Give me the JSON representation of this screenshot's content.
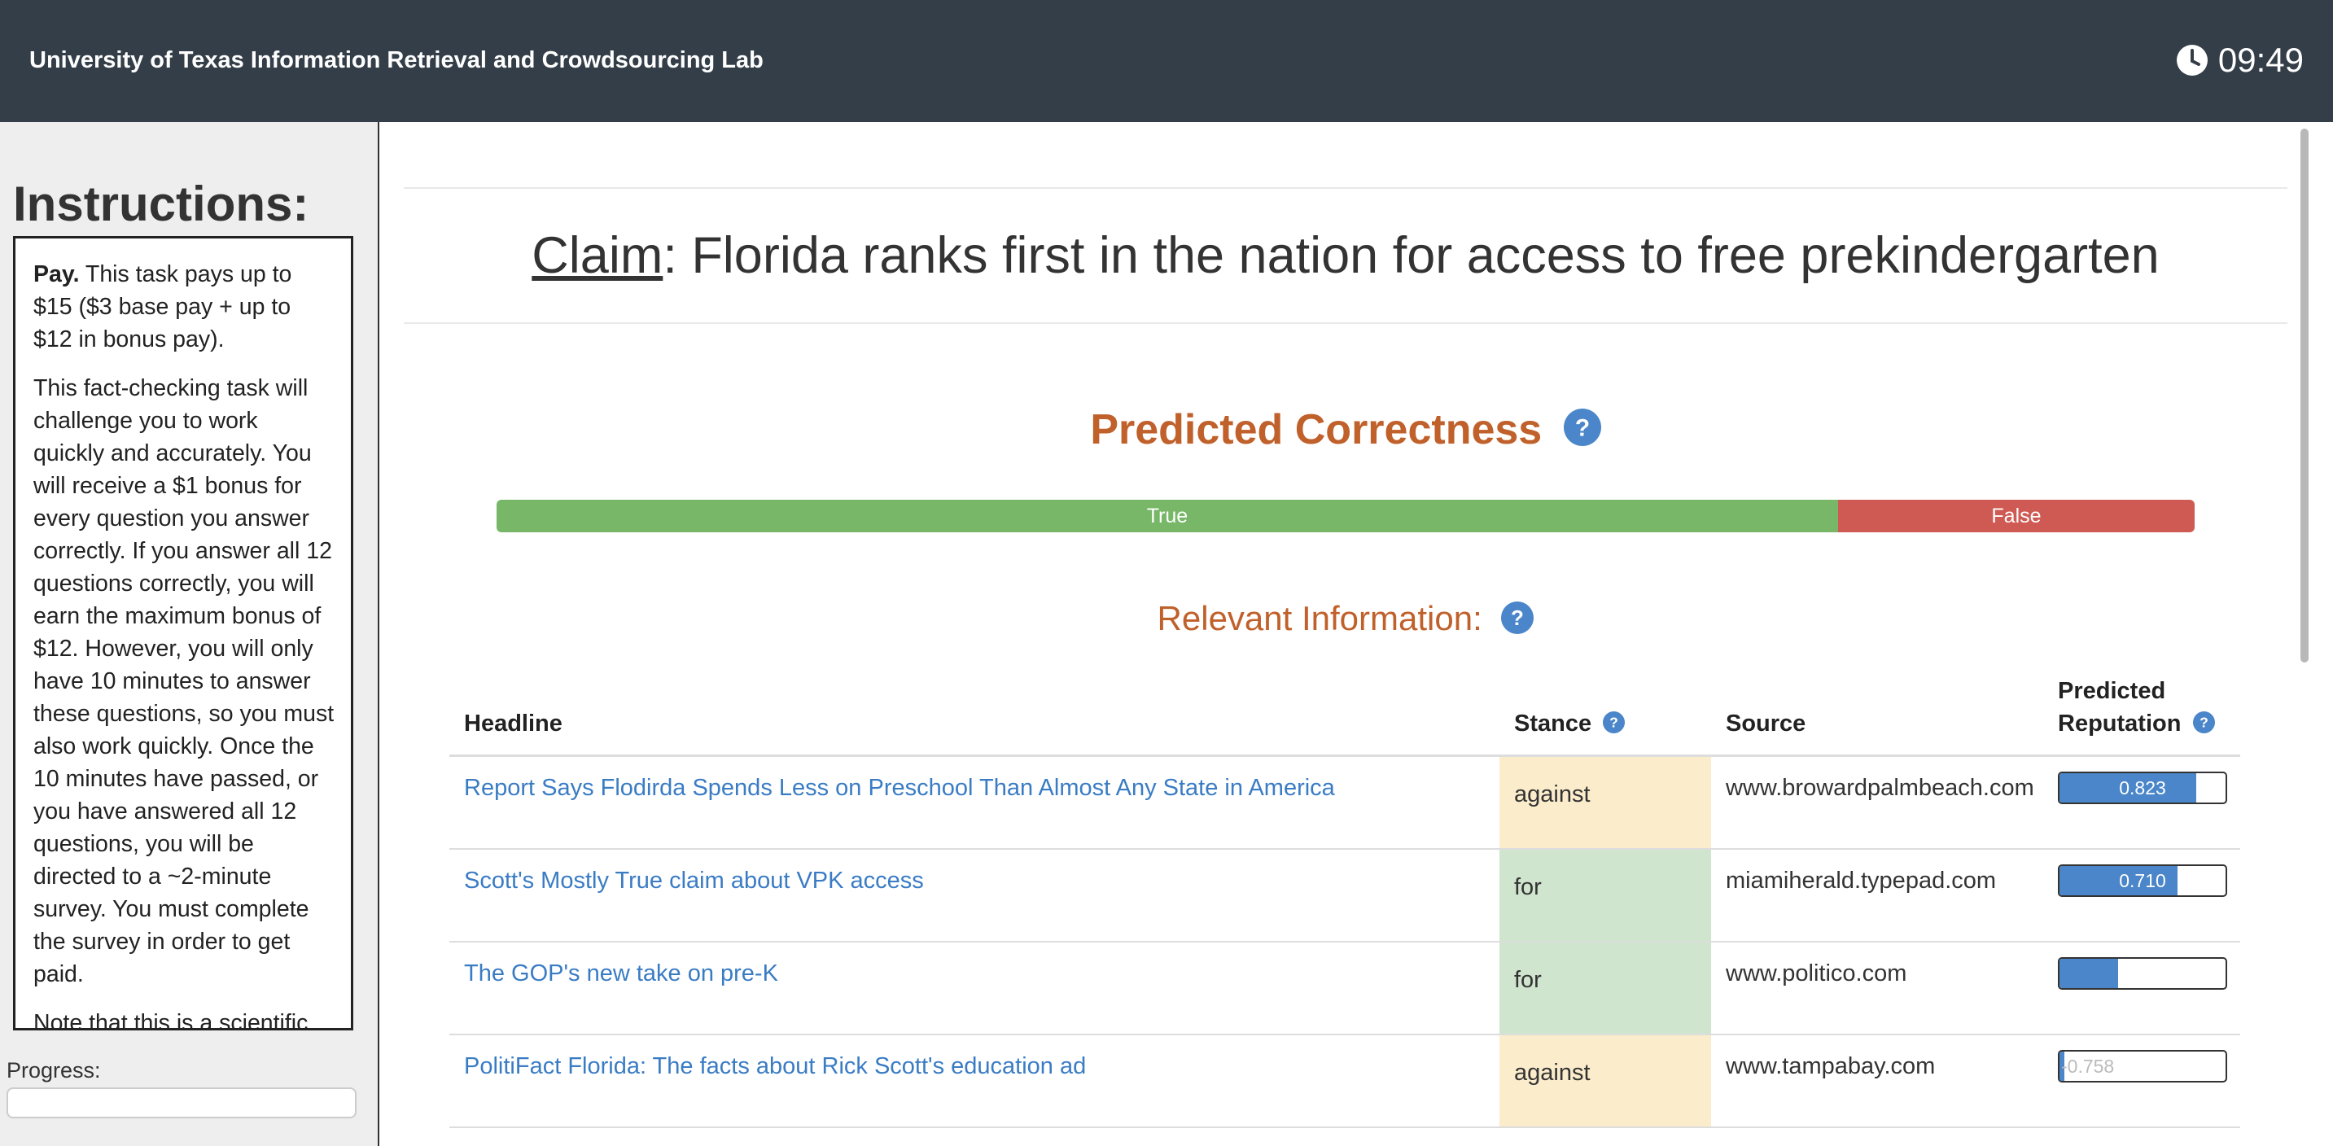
{
  "header": {
    "lab_title": "University of Texas Information Retrieval and Crowdsourcing Lab",
    "timer": "09:49",
    "timer_icon": "clock-icon"
  },
  "sidebar": {
    "title": "Instructions:",
    "pay_label": "Pay.",
    "pay_text": " This task pays up to $15 ($3 base pay + up to $12 in bonus pay).",
    "paragraph_2": "This fact-checking task will challenge you to work quickly and accurately. You will receive a $1 bonus for every question you answer correctly. If you answer all 12 questions correctly, you will earn the maximum bonus of $12. However, you will only have 10 minutes to answer these questions, so you must also work quickly. Once the 10 minutes have passed, or you have answered all 12 questions, you will be directed to a ~2-minute survey. You must complete the survey in order to get paid.",
    "paragraph_3": "Note that this is a scientific",
    "progress_label": "Progress:",
    "progress_value": 0
  },
  "claim": {
    "label": "Claim",
    "text": ": Florida ranks first in the nation for access to free prekindergarten"
  },
  "correctness": {
    "title": "Predicted Correctness",
    "true_label": "True",
    "false_label": "False",
    "true_fraction": 0.79,
    "true_color": "#77b767",
    "false_color": "#cf5a53"
  },
  "relevant": {
    "title": "Relevant Information:",
    "columns": {
      "headline": "Headline",
      "stance": "Stance",
      "source": "Source",
      "rep_line1": "Predicted",
      "rep_line2": "Reputation"
    },
    "rows": [
      {
        "headline": "Report Says Flodirda Spends Less on Preschool Than Almost Any State in America",
        "stance": "against",
        "source": "www.browardpalmbeach.com",
        "reputation": "0.823",
        "rep_value": 0.823
      },
      {
        "headline": "Scott's Mostly True claim about VPK access",
        "stance": "for",
        "source": "miamiherald.typepad.com",
        "reputation": "0.710",
        "rep_value": 0.71
      },
      {
        "headline": "The GOP's new take on pre-K",
        "stance": "for",
        "source": "www.politico.com",
        "reputation": "0.352",
        "rep_value": 0.352
      },
      {
        "headline": "PolitiFact Florida: The facts about Rick Scott's education ad",
        "stance": "against",
        "source": "www.tampabay.com",
        "reputation": "-0.758",
        "rep_value": 0.0
      }
    ]
  },
  "colors": {
    "accent": "#c0602a",
    "link": "#3a7cc4",
    "help_icon": "#4a86c9",
    "header_bg": "#343e48"
  }
}
